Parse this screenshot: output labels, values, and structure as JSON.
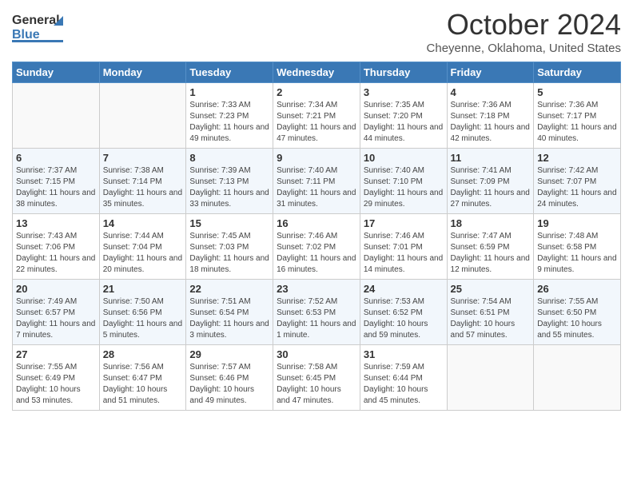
{
  "header": {
    "logo_general": "General",
    "logo_blue": "Blue",
    "title": "October 2024",
    "location": "Cheyenne, Oklahoma, United States"
  },
  "weekdays": [
    "Sunday",
    "Monday",
    "Tuesday",
    "Wednesday",
    "Thursday",
    "Friday",
    "Saturday"
  ],
  "weeks": [
    [
      {
        "day": "",
        "info": ""
      },
      {
        "day": "",
        "info": ""
      },
      {
        "day": "1",
        "info": "Sunrise: 7:33 AM\nSunset: 7:23 PM\nDaylight: 11 hours and 49 minutes."
      },
      {
        "day": "2",
        "info": "Sunrise: 7:34 AM\nSunset: 7:21 PM\nDaylight: 11 hours and 47 minutes."
      },
      {
        "day": "3",
        "info": "Sunrise: 7:35 AM\nSunset: 7:20 PM\nDaylight: 11 hours and 44 minutes."
      },
      {
        "day": "4",
        "info": "Sunrise: 7:36 AM\nSunset: 7:18 PM\nDaylight: 11 hours and 42 minutes."
      },
      {
        "day": "5",
        "info": "Sunrise: 7:36 AM\nSunset: 7:17 PM\nDaylight: 11 hours and 40 minutes."
      }
    ],
    [
      {
        "day": "6",
        "info": "Sunrise: 7:37 AM\nSunset: 7:15 PM\nDaylight: 11 hours and 38 minutes."
      },
      {
        "day": "7",
        "info": "Sunrise: 7:38 AM\nSunset: 7:14 PM\nDaylight: 11 hours and 35 minutes."
      },
      {
        "day": "8",
        "info": "Sunrise: 7:39 AM\nSunset: 7:13 PM\nDaylight: 11 hours and 33 minutes."
      },
      {
        "day": "9",
        "info": "Sunrise: 7:40 AM\nSunset: 7:11 PM\nDaylight: 11 hours and 31 minutes."
      },
      {
        "day": "10",
        "info": "Sunrise: 7:40 AM\nSunset: 7:10 PM\nDaylight: 11 hours and 29 minutes."
      },
      {
        "day": "11",
        "info": "Sunrise: 7:41 AM\nSunset: 7:09 PM\nDaylight: 11 hours and 27 minutes."
      },
      {
        "day": "12",
        "info": "Sunrise: 7:42 AM\nSunset: 7:07 PM\nDaylight: 11 hours and 24 minutes."
      }
    ],
    [
      {
        "day": "13",
        "info": "Sunrise: 7:43 AM\nSunset: 7:06 PM\nDaylight: 11 hours and 22 minutes."
      },
      {
        "day": "14",
        "info": "Sunrise: 7:44 AM\nSunset: 7:04 PM\nDaylight: 11 hours and 20 minutes."
      },
      {
        "day": "15",
        "info": "Sunrise: 7:45 AM\nSunset: 7:03 PM\nDaylight: 11 hours and 18 minutes."
      },
      {
        "day": "16",
        "info": "Sunrise: 7:46 AM\nSunset: 7:02 PM\nDaylight: 11 hours and 16 minutes."
      },
      {
        "day": "17",
        "info": "Sunrise: 7:46 AM\nSunset: 7:01 PM\nDaylight: 11 hours and 14 minutes."
      },
      {
        "day": "18",
        "info": "Sunrise: 7:47 AM\nSunset: 6:59 PM\nDaylight: 11 hours and 12 minutes."
      },
      {
        "day": "19",
        "info": "Sunrise: 7:48 AM\nSunset: 6:58 PM\nDaylight: 11 hours and 9 minutes."
      }
    ],
    [
      {
        "day": "20",
        "info": "Sunrise: 7:49 AM\nSunset: 6:57 PM\nDaylight: 11 hours and 7 minutes."
      },
      {
        "day": "21",
        "info": "Sunrise: 7:50 AM\nSunset: 6:56 PM\nDaylight: 11 hours and 5 minutes."
      },
      {
        "day": "22",
        "info": "Sunrise: 7:51 AM\nSunset: 6:54 PM\nDaylight: 11 hours and 3 minutes."
      },
      {
        "day": "23",
        "info": "Sunrise: 7:52 AM\nSunset: 6:53 PM\nDaylight: 11 hours and 1 minute."
      },
      {
        "day": "24",
        "info": "Sunrise: 7:53 AM\nSunset: 6:52 PM\nDaylight: 10 hours and 59 minutes."
      },
      {
        "day": "25",
        "info": "Sunrise: 7:54 AM\nSunset: 6:51 PM\nDaylight: 10 hours and 57 minutes."
      },
      {
        "day": "26",
        "info": "Sunrise: 7:55 AM\nSunset: 6:50 PM\nDaylight: 10 hours and 55 minutes."
      }
    ],
    [
      {
        "day": "27",
        "info": "Sunrise: 7:55 AM\nSunset: 6:49 PM\nDaylight: 10 hours and 53 minutes."
      },
      {
        "day": "28",
        "info": "Sunrise: 7:56 AM\nSunset: 6:47 PM\nDaylight: 10 hours and 51 minutes."
      },
      {
        "day": "29",
        "info": "Sunrise: 7:57 AM\nSunset: 6:46 PM\nDaylight: 10 hours and 49 minutes."
      },
      {
        "day": "30",
        "info": "Sunrise: 7:58 AM\nSunset: 6:45 PM\nDaylight: 10 hours and 47 minutes."
      },
      {
        "day": "31",
        "info": "Sunrise: 7:59 AM\nSunset: 6:44 PM\nDaylight: 10 hours and 45 minutes."
      },
      {
        "day": "",
        "info": ""
      },
      {
        "day": "",
        "info": ""
      }
    ]
  ]
}
